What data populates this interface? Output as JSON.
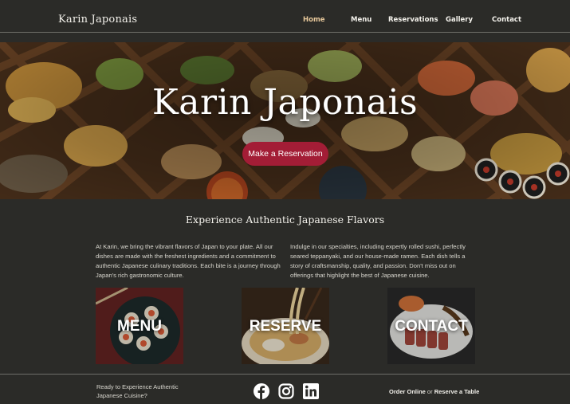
{
  "header": {
    "brand": "Karin Japonais",
    "nav": [
      {
        "label": "Home",
        "active": true
      },
      {
        "label": "Menu",
        "active": false
      },
      {
        "label": "Reservations",
        "active": false
      },
      {
        "label": "Gallery",
        "active": false
      },
      {
        "label": "Contact",
        "active": false
      }
    ]
  },
  "hero": {
    "title": "Karin Japonais",
    "button_label": "Make a Reservation"
  },
  "intro": {
    "title": "Experience Authentic Japanese Flavors",
    "paragraph_left": "At Karin, we bring the vibrant flavors of Japan to your plate. All our dishes are made with the freshest ingredients and a commitment to authentic Japanese culinary traditions.  Each bite is a journey through Japan's rich gastronomic culture.",
    "paragraph_right": "Indulge in our  specialties, including expertly rolled sushi, perfectly seared teppanyaki, and our house-made ramen. Each dish tells a story of craftsmanship, quality, and passion. Don't miss out on offerings that highlight the best of Japanese cuisine."
  },
  "cards": [
    {
      "label": "MENU"
    },
    {
      "label": "RESERVE"
    },
    {
      "label": "CONTACT"
    }
  ],
  "footer": {
    "cta": "Ready to Experience Authentic Japanese Cuisine?",
    "social_icons": [
      "facebook-icon",
      "instagram-icon",
      "linkedin-icon"
    ],
    "order_online": "Order Online",
    "or": " or ",
    "reserve_table": "Reserve a Table"
  },
  "colors": {
    "background": "#2b2b28",
    "accent": "#a31d36",
    "active_nav": "#e6c79a"
  }
}
